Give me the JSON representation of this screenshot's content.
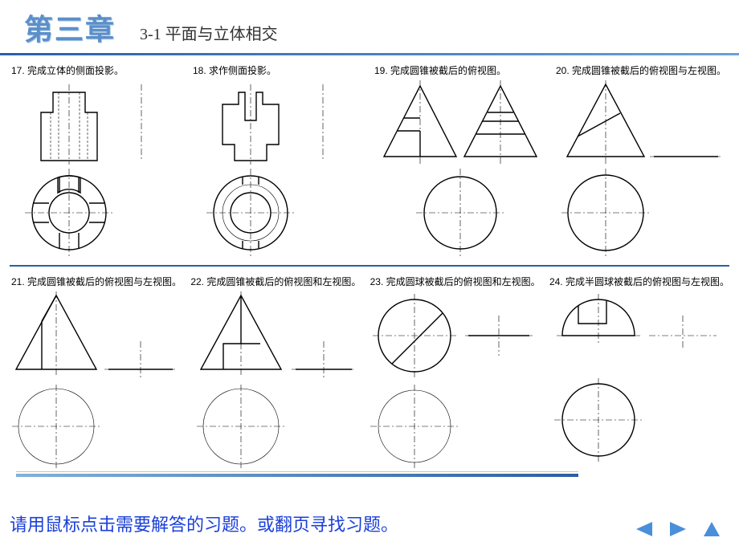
{
  "header": {
    "chapter": "第三章",
    "section": "3-1  平面与立体相交"
  },
  "problems": [
    {
      "num": "17",
      "text": "完成立体的侧面投影。"
    },
    {
      "num": "18",
      "text": "求作侧面投影。"
    },
    {
      "num": "19",
      "text": "完成圆锥被截后的俯视图。"
    },
    {
      "num": "20",
      "text": "完成圆锥被截后的俯视图与左视图。"
    },
    {
      "num": "21",
      "text": "完成圆锥被截后的俯视图与左视图。"
    },
    {
      "num": "22",
      "text": "完成圆锥被截后的俯视图和左视图。"
    },
    {
      "num": "23",
      "text": "完成圆球被截后的俯视图和左视图。"
    },
    {
      "num": "24",
      "text": "完成半圆球被截后的俯视图与左视图。"
    }
  ],
  "footer": {
    "hint": "请用鼠标点击需要解答的习题。或翻页寻找习题。"
  },
  "nav": {
    "prev": "prev",
    "next": "next",
    "home": "home"
  }
}
